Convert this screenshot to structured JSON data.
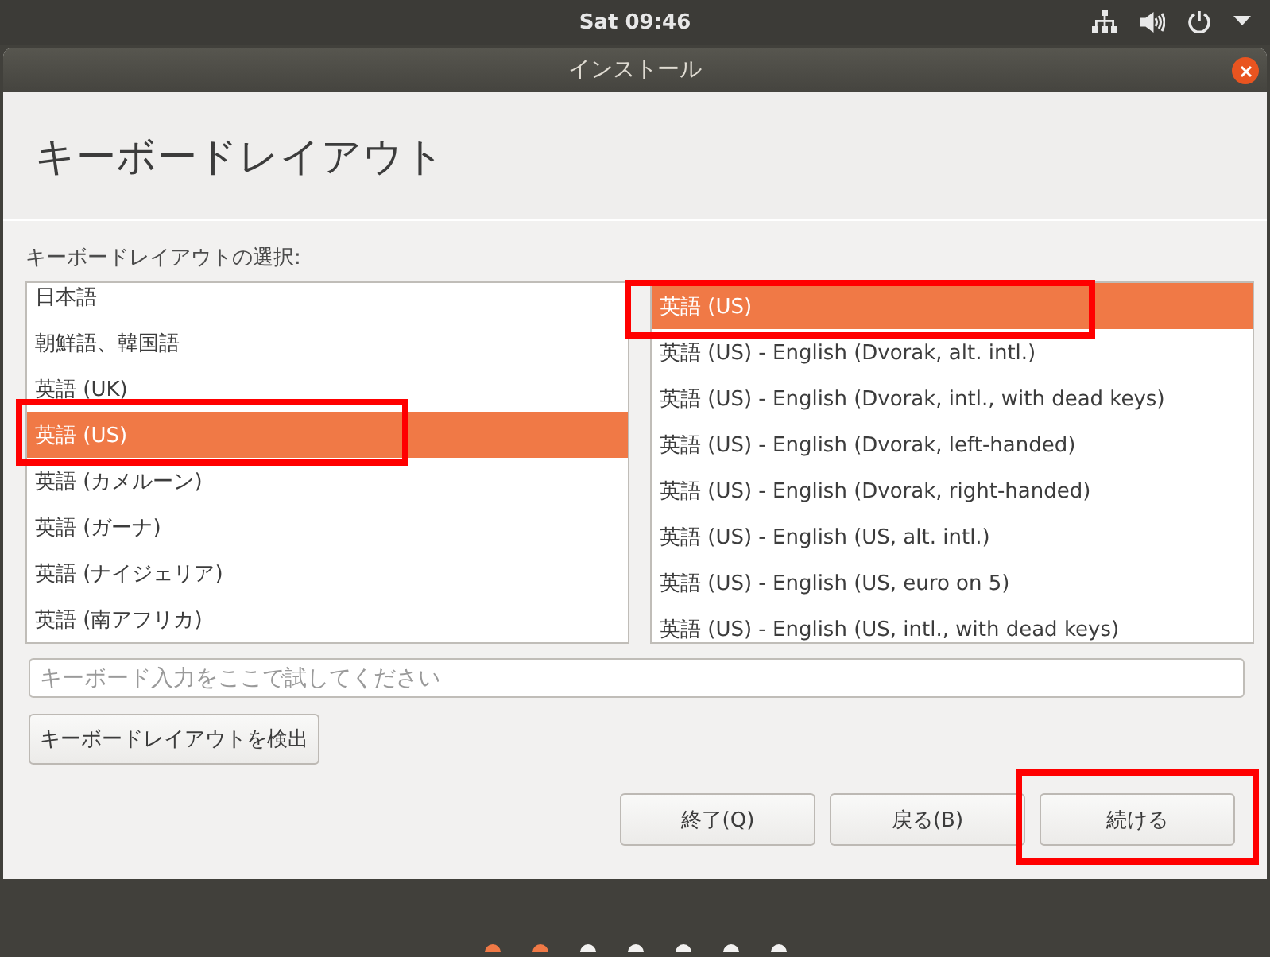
{
  "top_bar": {
    "clock": "Sat 09:46"
  },
  "window": {
    "title": "インストール"
  },
  "header": {
    "title": "キーボードレイアウト"
  },
  "layout_label": "キーボードレイアウトの選択:",
  "languages": [
    {
      "label": "日本語",
      "selected": false,
      "highlighted": false
    },
    {
      "label": "朝鮮語、韓国語",
      "selected": false,
      "highlighted": false
    },
    {
      "label": "英語 (UK)",
      "selected": false,
      "highlighted": false
    },
    {
      "label": "英語 (US)",
      "selected": true,
      "highlighted": true
    },
    {
      "label": "英語 (カメルーン)",
      "selected": false,
      "highlighted": false
    },
    {
      "label": "英語 (ガーナ)",
      "selected": false,
      "highlighted": false
    },
    {
      "label": "英語 (ナイジェリア)",
      "selected": false,
      "highlighted": false
    },
    {
      "label": "英語 (南アフリカ)",
      "selected": false,
      "highlighted": false
    }
  ],
  "variants": [
    {
      "label": "英語 (US)",
      "selected": true,
      "highlighted": true
    },
    {
      "label": "英語 (US) - English (Dvorak, alt. intl.)",
      "selected": false,
      "highlighted": false
    },
    {
      "label": "英語 (US) - English (Dvorak, intl., with dead keys)",
      "selected": false,
      "highlighted": false
    },
    {
      "label": "英語 (US) - English (Dvorak, left-handed)",
      "selected": false,
      "highlighted": false
    },
    {
      "label": "英語 (US) - English (Dvorak, right-handed)",
      "selected": false,
      "highlighted": false
    },
    {
      "label": "英語 (US) - English (US, alt. intl.)",
      "selected": false,
      "highlighted": false
    },
    {
      "label": "英語 (US) - English (US, euro on 5)",
      "selected": false,
      "highlighted": false
    },
    {
      "label": "英語 (US) - English (US, intl., with dead keys)",
      "selected": false,
      "highlighted": false
    }
  ],
  "test_field": {
    "placeholder": "キーボード入力をここで試してください"
  },
  "detect_button": "キーボードレイアウトを検出",
  "buttons": [
    {
      "label": "終了(Q)",
      "highlighted": false
    },
    {
      "label": "戻る(B)",
      "highlighted": false
    },
    {
      "label": "続ける",
      "highlighted": true
    }
  ],
  "steps": [
    {
      "done": true
    },
    {
      "done": true
    },
    {
      "done": false
    },
    {
      "done": false
    },
    {
      "done": false
    },
    {
      "done": false
    },
    {
      "done": false
    }
  ]
}
